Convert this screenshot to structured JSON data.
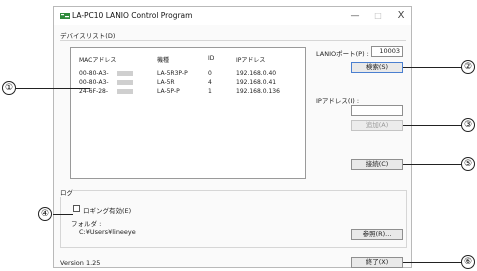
{
  "window": {
    "title": "LA-PC10 LANIO Control Program",
    "minimize": "—",
    "maximize": "□",
    "close": "X"
  },
  "device_list": {
    "label": "デバイスリスト(D)",
    "columns": [
      "MACアドレス",
      "機種",
      "ID",
      "IPアドレス"
    ],
    "rows": [
      {
        "mac": "00-80-A3-",
        "model": "LA-5R3P-P",
        "id": "0",
        "ip": "192.168.0.40"
      },
      {
        "mac": "00-80-A3-",
        "model": "LA-5R",
        "id": "4",
        "ip": "192.168.0.41"
      },
      {
        "mac": "24-6F-28-",
        "model": "LA-5P-P",
        "id": "1",
        "ip": "192.168.0.136"
      }
    ]
  },
  "lanio_port": {
    "label": "LANIOポート(P) :",
    "value": "10003"
  },
  "search_button": "検索(S)",
  "ip_address": {
    "label": "IPアドレス(I) :",
    "value": ""
  },
  "add_button": "追加(A)",
  "connect_button": "接続(C)",
  "log": {
    "label": "ログ",
    "logging_checkbox": "ロギング有効(E)",
    "folder_label": "フォルダ :",
    "folder_path": "C:¥Users¥lineeye",
    "browse_button": "参照(R)..."
  },
  "version": "Version 1.25",
  "exit_button": "終了(X)",
  "callouts": [
    "①",
    "②",
    "③",
    "④",
    "⑤",
    "⑥"
  ]
}
